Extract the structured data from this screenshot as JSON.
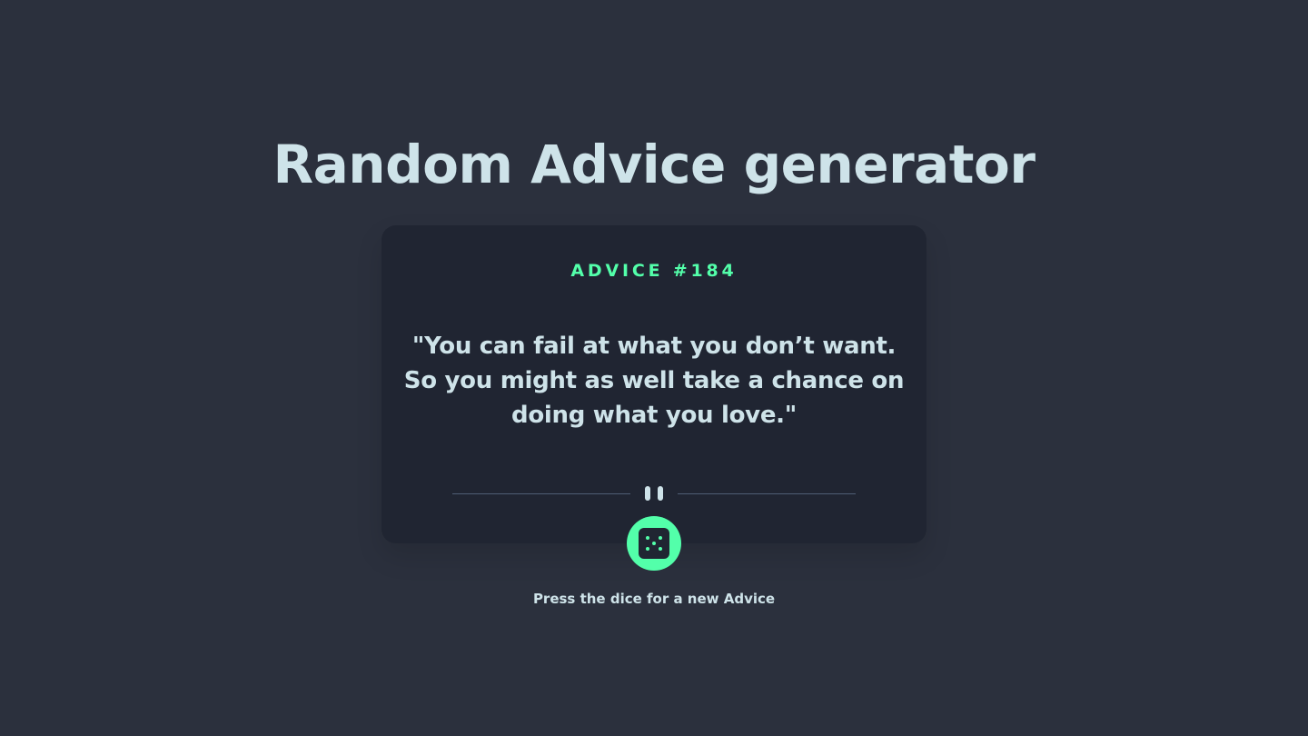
{
  "header": {
    "title": "Random Advice generator"
  },
  "advice": {
    "id_label": "ADVICE #184",
    "quote": "\"You can fail at what you don’t want. So you might as well take a chance on doing what you love.\""
  },
  "controls": {
    "dice_icon": "dice-icon",
    "divider_icon": "pause-icon",
    "hint": "Press the dice for a new Advice"
  },
  "colors": {
    "background": "#2b303d",
    "card": "#202532",
    "accent": "#53ffaa",
    "text": "#cee3e9",
    "divider": "#4f5d74"
  }
}
